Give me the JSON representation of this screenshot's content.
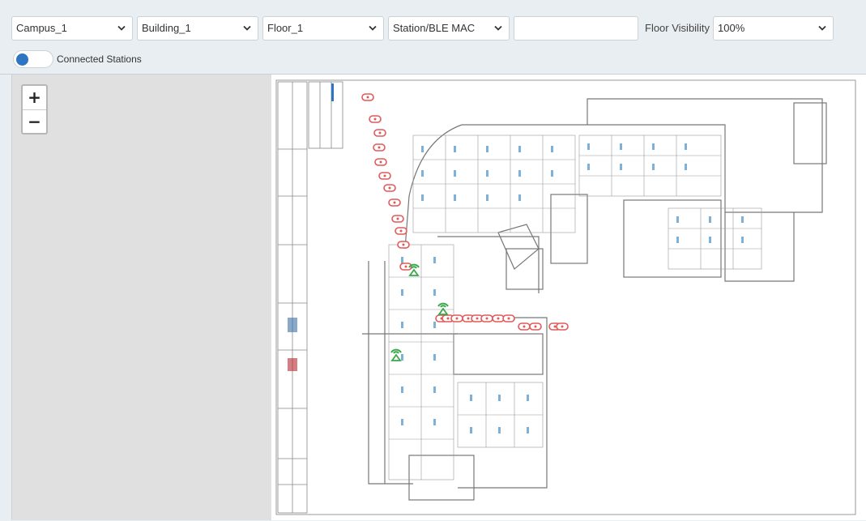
{
  "filters": {
    "campus": "Campus_1",
    "building": "Building_1",
    "floor": "Floor_1",
    "search_type": "Station/BLE MAC",
    "search_value": "",
    "floor_visibility_label": "Floor Visibility",
    "floor_visibility": "100%"
  },
  "toggle": {
    "label": "Connected Stations",
    "state": "on"
  },
  "zoom": {
    "in_label": "+",
    "out_label": "−"
  },
  "colors": {
    "background": "#e8eef1",
    "toggle_knob": "#2d74c2",
    "access_point_marker": "#e05a5a",
    "station_marker": "#3aa84a"
  },
  "icons": {
    "select_arrow": "chevron-down-icon",
    "access_point": "access-point-icon",
    "station": "station-icon"
  }
}
